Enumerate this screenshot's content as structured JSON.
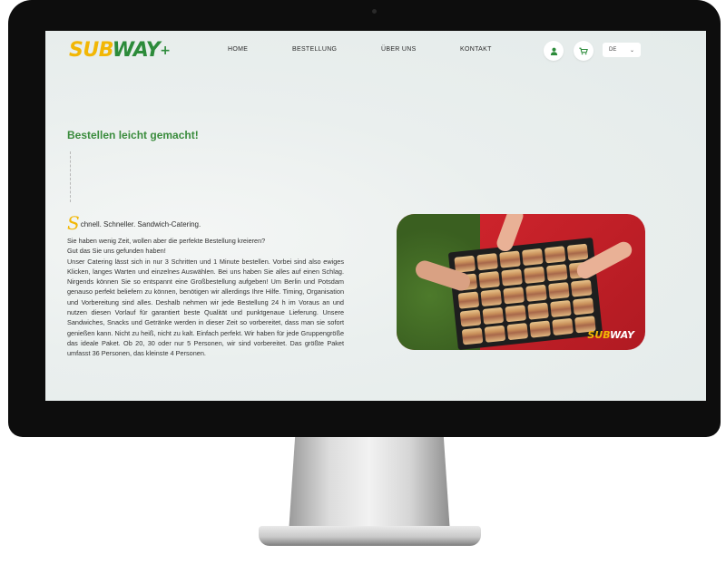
{
  "brand": {
    "logo_sub": "SUB",
    "logo_way": "WAY",
    "logo_plus": "+"
  },
  "nav": {
    "home": "HOME",
    "bestellung": "BESTELLUNG",
    "ueber_uns": "ÜBER UNS",
    "kontakt": "KONTAKT"
  },
  "header_icons": {
    "account": "user-icon",
    "cart": "cart-icon"
  },
  "language": {
    "selected": "DE",
    "chevron": "⌄"
  },
  "main": {
    "headline": "Bestellen leicht gemacht!",
    "tagline_initial": "S",
    "tagline_rest": "chnell. Schneller. Sandwich-Catering.",
    "body": "Sie haben wenig Zeit, wollen aber die perfekte Bestellung kreieren?\nGut das Sie uns gefunden haben!\nUnser Catering lässt sich in nur 3 Schritten und 1 Minute bestellen. Vorbei sind also ewiges Klicken, langes Warten und einzelnes Auswählen. Bei uns haben Sie alles auf einen Schlag. Nirgends können Sie so entspannt eine Großbestellung aufgeben! Um Berlin und Potsdam genauso perfekt beliefern zu können, benötigen wir allerdings Ihre Hilfe. Timing, Organisation und Vorbereitung sind alles. Deshalb nehmen wir jede Bestellung 24 h im Voraus an und nutzen diesen Vorlauf für garantiert beste Qualität und punktgenaue Lieferung. Unsere Sandwiches, Snacks und Getränke werden in dieser Zeit so vorbereitet, dass man sie sofort genießen kann. Nicht zu heiß, nicht zu kalt. Einfach perfekt. Wir haben für jede Gruppengröße das ideale Paket. Ob 20, 30 oder nur 5 Personen, wir sind vorbereitet. Das größte Paket umfasst 36 Personen, das kleinste 4 Personen."
  },
  "photo": {
    "logo_sub": "SUB",
    "logo_way": "WAY"
  },
  "colors": {
    "brand_green": "#2c8b3a",
    "brand_yellow": "#f2b705",
    "photo_red": "#c8232b"
  }
}
